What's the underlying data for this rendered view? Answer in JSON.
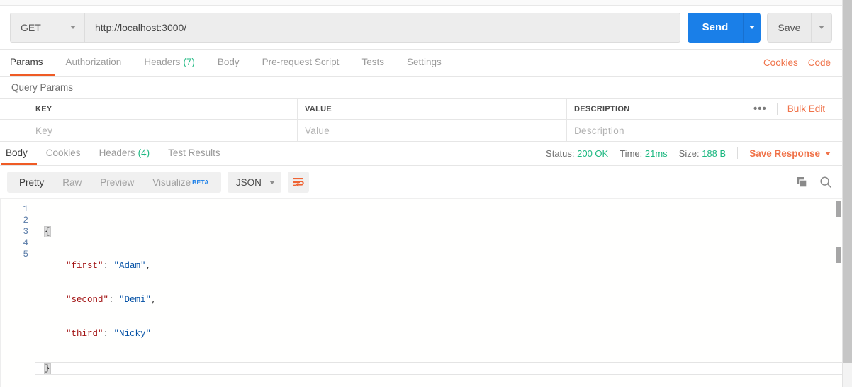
{
  "request": {
    "method": "GET",
    "url": "http://localhost:3000/",
    "send_label": "Send",
    "save_label": "Save",
    "tabs": [
      {
        "label": "Params",
        "count": "",
        "active": true
      },
      {
        "label": "Authorization",
        "count": "",
        "active": false
      },
      {
        "label": "Headers",
        "count": "(7)",
        "active": false
      },
      {
        "label": "Body",
        "count": "",
        "active": false
      },
      {
        "label": "Pre-request Script",
        "count": "",
        "active": false
      },
      {
        "label": "Tests",
        "count": "",
        "active": false
      },
      {
        "label": "Settings",
        "count": "",
        "active": false
      }
    ],
    "links": [
      {
        "label": "Cookies"
      },
      {
        "label": "Code"
      }
    ]
  },
  "query_params": {
    "title": "Query Params",
    "headers": {
      "key": "KEY",
      "value": "VALUE",
      "description": "DESCRIPTION"
    },
    "dots": "•••",
    "bulk_edit": "Bulk Edit",
    "rows": [
      {
        "key_placeholder": "Key",
        "value_placeholder": "Value",
        "description_placeholder": "Description"
      }
    ]
  },
  "response": {
    "tabs": [
      {
        "label": "Body",
        "count": "",
        "active": true
      },
      {
        "label": "Cookies",
        "count": "",
        "active": false
      },
      {
        "label": "Headers",
        "count": "(4)",
        "active": false
      },
      {
        "label": "Test Results",
        "count": "",
        "active": false
      }
    ],
    "meta": {
      "status_label": "Status:",
      "status_value": "200 OK",
      "time_label": "Time:",
      "time_value": "21ms",
      "size_label": "Size:",
      "size_value": "188 B",
      "save_response": "Save Response"
    },
    "view_modes": [
      {
        "label": "Pretty",
        "active": true,
        "badge": ""
      },
      {
        "label": "Raw",
        "active": false,
        "badge": ""
      },
      {
        "label": "Preview",
        "active": false,
        "badge": ""
      },
      {
        "label": "Visualize",
        "active": false,
        "badge": "BETA"
      }
    ],
    "format": "JSON",
    "icons": {
      "wrap": "word-wrap-icon",
      "copy": "copy-icon",
      "search": "search-icon"
    },
    "body_lines": [
      {
        "num": "1",
        "open_brace": "{"
      },
      {
        "num": "2",
        "key": "\"first\"",
        "sep": ": ",
        "val": "\"Adam\"",
        "tail": ","
      },
      {
        "num": "3",
        "key": "\"second\"",
        "sep": ": ",
        "val": "\"Demi\"",
        "tail": ","
      },
      {
        "num": "4",
        "key": "\"third\"",
        "sep": ": ",
        "val": "\"Nicky\"",
        "tail": ""
      },
      {
        "num": "5",
        "close_brace": "}"
      }
    ]
  },
  "colors": {
    "accent_orange": "#ef5b25",
    "link_orange": "#f0734a",
    "send_blue": "#1a7fe8",
    "status_green": "#1db881",
    "json_key": "#a31515",
    "json_string": "#0451a5"
  }
}
